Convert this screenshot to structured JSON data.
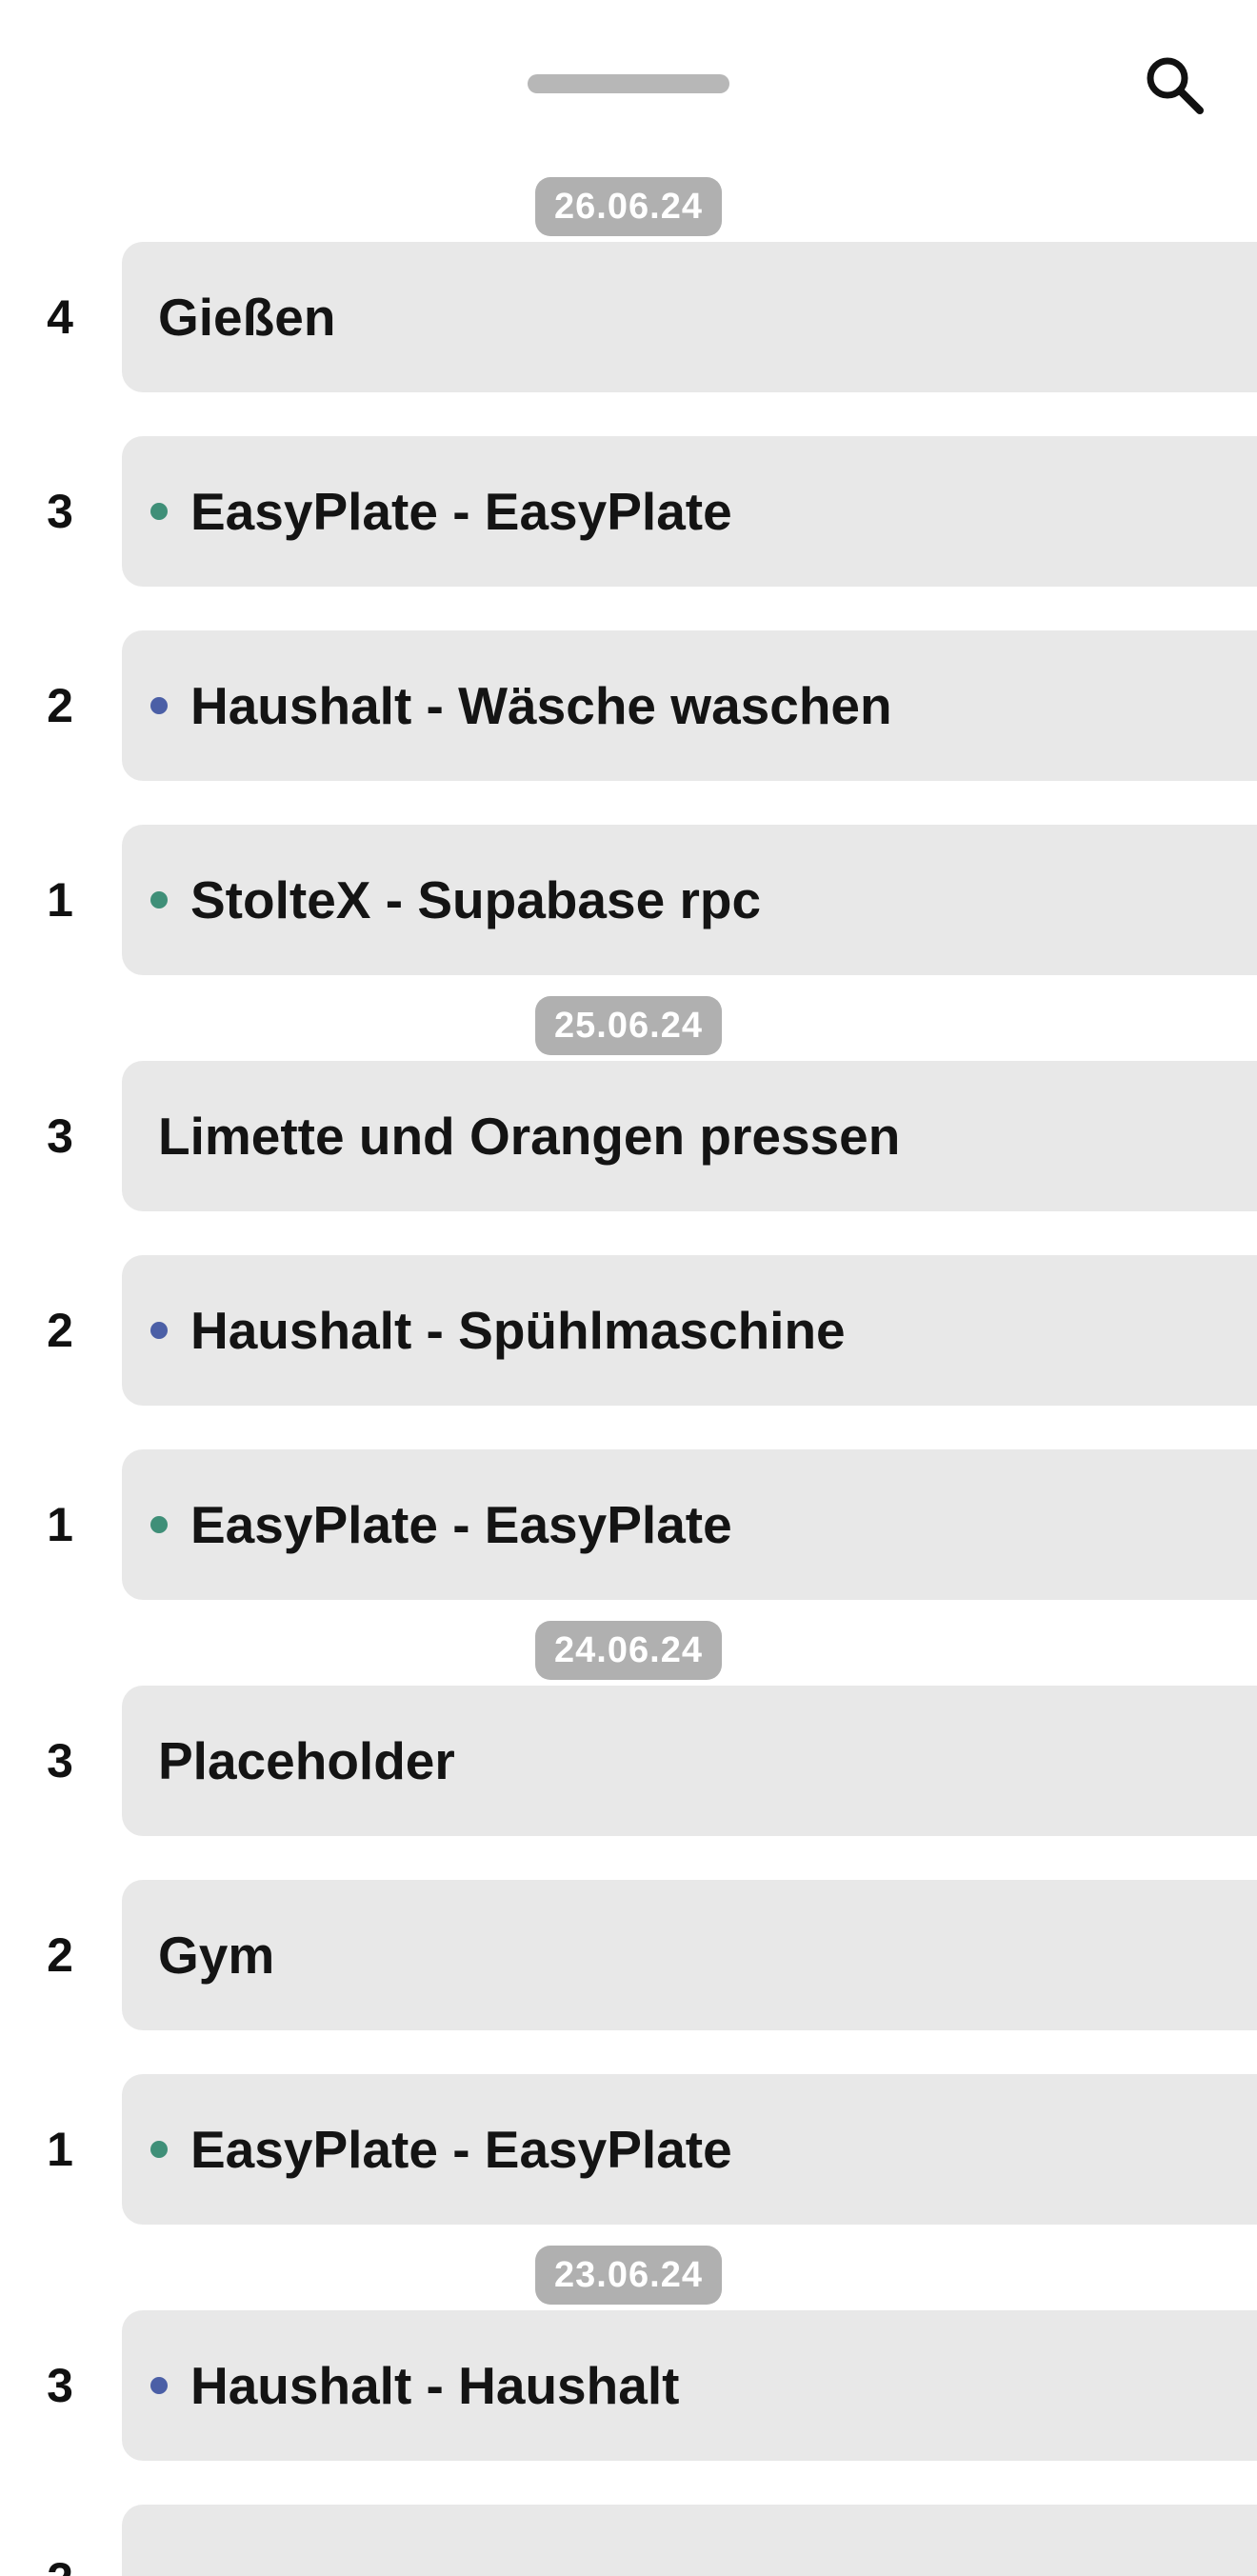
{
  "colors": {
    "green_dot": "#3f8f78",
    "blue_dot": "#4b5fa6",
    "date_chip": "#b0b0b0",
    "card_bg": "#e8e8e8"
  },
  "header": {
    "search_icon": "search-icon"
  },
  "groups": [
    {
      "date": "26.06.24",
      "entries": [
        {
          "count": "4",
          "title": "Gießen",
          "dot": "none"
        },
        {
          "count": "3",
          "title": "EasyPlate - EasyPlate",
          "dot": "green"
        },
        {
          "count": "2",
          "title": "Haushalt - Wäsche waschen",
          "dot": "blue"
        },
        {
          "count": "1",
          "title": "StolteX - Supabase rpc",
          "dot": "green"
        }
      ]
    },
    {
      "date": "25.06.24",
      "entries": [
        {
          "count": "3",
          "title": "Limette und Orangen pressen",
          "dot": "none"
        },
        {
          "count": "2",
          "title": "Haushalt - Spühlmaschine",
          "dot": "blue"
        },
        {
          "count": "1",
          "title": "EasyPlate - EasyPlate",
          "dot": "green"
        }
      ]
    },
    {
      "date": "24.06.24",
      "entries": [
        {
          "count": "3",
          "title": "Placeholder",
          "dot": "none"
        },
        {
          "count": "2",
          "title": "Gym",
          "dot": "none"
        },
        {
          "count": "1",
          "title": "EasyPlate - EasyPlate",
          "dot": "green"
        }
      ]
    },
    {
      "date": "23.06.24",
      "entries": [
        {
          "count": "3",
          "title": "Haushalt - Haushalt",
          "dot": "blue"
        },
        {
          "count": "2",
          "title": "",
          "dot": "none"
        }
      ]
    }
  ]
}
